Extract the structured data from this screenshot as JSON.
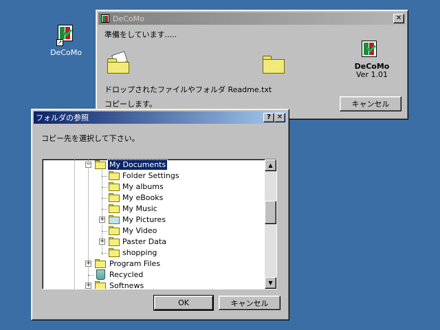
{
  "desktop": {
    "icon_label": "DeCoMo"
  },
  "decomo_window": {
    "title": "DeCoMo",
    "close_glyph": "✕",
    "status": "準備をしています.....",
    "message_line1": "ドロップされたファイルやフォルダ Readme.txt",
    "message_line2": "コピーします。",
    "app_name": "DeCoMo",
    "version": "Ver 1.01",
    "cancel_label": "キャンセル"
  },
  "browse_dialog": {
    "title": "フォルダの参照",
    "help_glyph": "?",
    "close_glyph": "✕",
    "prompt": "コピー先を選択して下さい。",
    "ok_label": "OK",
    "cancel_label": "キャンセル",
    "tree": [
      {
        "label": "My Documents",
        "expander": "−",
        "selected": true
      },
      {
        "label": "Folder Settings",
        "expander": ""
      },
      {
        "label": "My albums",
        "expander": ""
      },
      {
        "label": "My eBooks",
        "expander": ""
      },
      {
        "label": "My Music",
        "expander": ""
      },
      {
        "label": "My Pictures",
        "expander": "+"
      },
      {
        "label": "My Video",
        "expander": ""
      },
      {
        "label": "Paster Data",
        "expander": "+"
      },
      {
        "label": "shopping",
        "expander": ""
      },
      {
        "label": "Program Files",
        "expander": "+"
      },
      {
        "label": "Recycled",
        "expander": ""
      },
      {
        "label": "Softnews",
        "expander": "+"
      }
    ],
    "scroll_up_glyph": "▲",
    "scroll_down_glyph": "▼"
  },
  "icons": {
    "app": "decomo-app-icon",
    "folder": "folder-icon",
    "recycle": "recycle-bin-icon",
    "pictures": "pictures-folder-icon"
  },
  "colors": {
    "desktop": "#3a6ea5",
    "active_title": "#0a246a",
    "inactive_title": "#808080",
    "selection": "#0a246a"
  }
}
